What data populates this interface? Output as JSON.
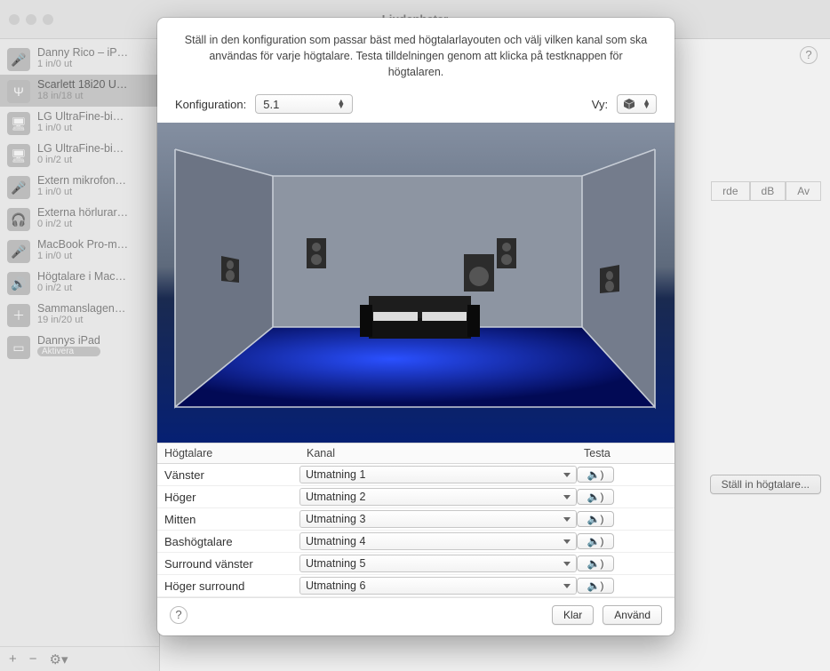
{
  "window_title": "Ljudenheter",
  "sidebar": {
    "items": [
      {
        "name": "Danny Rico – iP…",
        "sub": "1 in/0 ut",
        "icon": "mic"
      },
      {
        "name": "Scarlett 18i20 U…",
        "sub": "18 in/18 ut",
        "icon": "usb",
        "selected": true
      },
      {
        "name": "LG UltraFine-bi…",
        "sub": "1 in/0 ut",
        "icon": "display"
      },
      {
        "name": "LG UltraFine-bi…",
        "sub": "0 in/2 ut",
        "icon": "display"
      },
      {
        "name": "Extern mikrofon…",
        "sub": "1 in/0 ut",
        "icon": "mic"
      },
      {
        "name": "Externa hörlurar…",
        "sub": "0 in/2 ut",
        "icon": "headphones"
      },
      {
        "name": "MacBook Pro-m…",
        "sub": "1 in/0 ut",
        "icon": "mic"
      },
      {
        "name": "Högtalare i Mac…",
        "sub": "0 in/2 ut",
        "icon": "speaker"
      },
      {
        "name": "Sammanslagen…",
        "sub": "19 in/20 ut",
        "icon": "aggregate",
        "chevron": true
      },
      {
        "name": "Dannys iPad",
        "sub": "Aktivera",
        "icon": "ipad",
        "badge": true
      }
    ],
    "bottom": {
      "add": "+",
      "remove": "−",
      "gear": "⚙︎"
    }
  },
  "content_back": {
    "col_labels": [
      "rde",
      "dB",
      "Av"
    ],
    "bottom_button": "Ställ in högtalare..."
  },
  "dialog": {
    "intro": "Ställ in den konfiguration som passar bäst med högtalarlayouten och välj vilken kanal som ska användas för varje högtalare. Testa tilldelningen genom att klicka på testknappen för högtalaren.",
    "config_label": "Konfiguration:",
    "config_value": "5.1",
    "view_label": "Vy:",
    "table": {
      "headers": {
        "speaker": "Högtalare",
        "channel": "Kanal",
        "test": "Testa"
      },
      "rows": [
        {
          "spk": "Vänster",
          "ch": "Utmatning 1"
        },
        {
          "spk": "Höger",
          "ch": "Utmatning 2"
        },
        {
          "spk": "Mitten",
          "ch": "Utmatning 3"
        },
        {
          "spk": "Bashögtalare",
          "ch": "Utmatning 4"
        },
        {
          "spk": "Surround vänster",
          "ch": "Utmatning 5"
        },
        {
          "spk": "Höger surround",
          "ch": "Utmatning 6"
        }
      ]
    },
    "footer": {
      "done": "Klar",
      "apply": "Använd"
    }
  },
  "icons": {
    "mic": "🎤",
    "usb": "Ψ",
    "display": "🖥",
    "headphones": "🎧",
    "speaker": "🔊",
    "aggregate": "＋",
    "ipad": "▭",
    "cube": "⬢",
    "sound": "🔈"
  }
}
